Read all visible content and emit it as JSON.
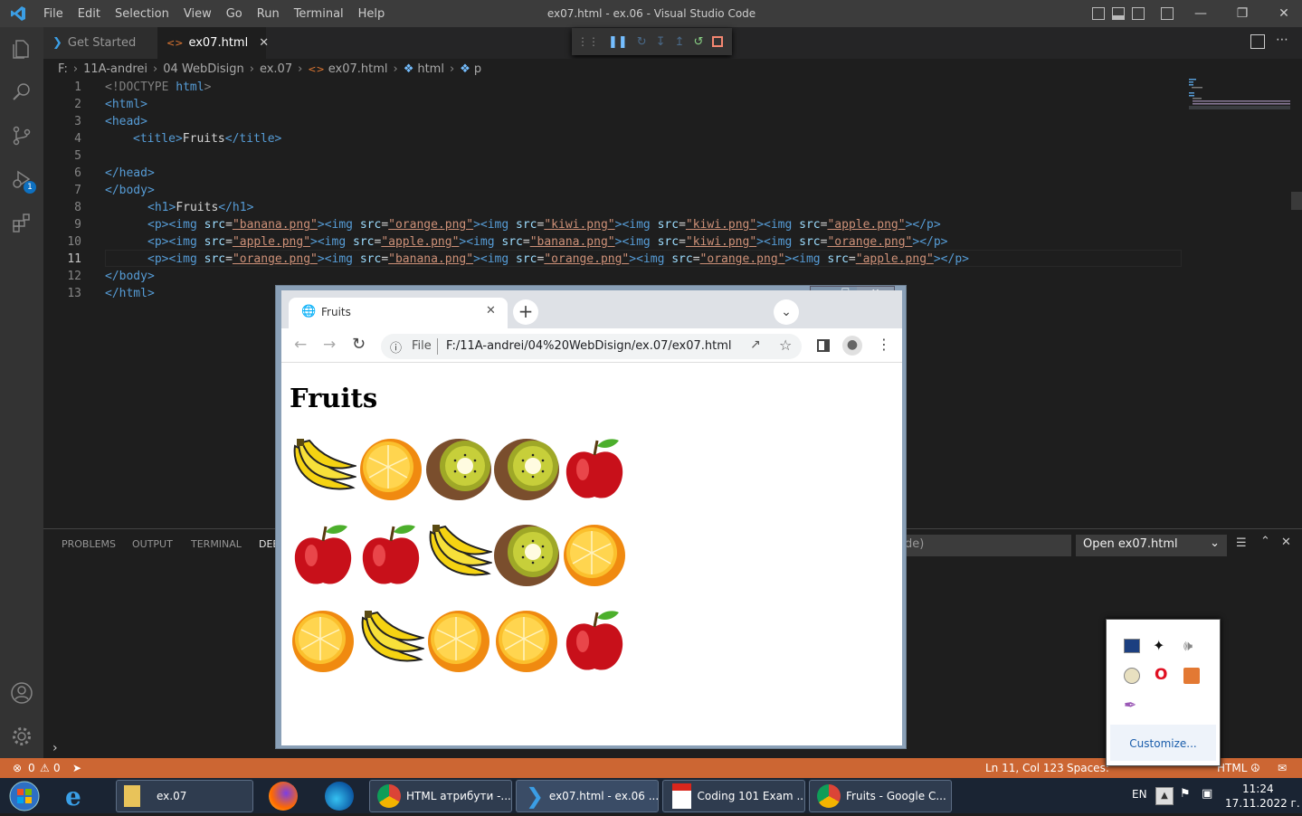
{
  "vscode": {
    "menu": [
      "File",
      "Edit",
      "Selection",
      "View",
      "Go",
      "Run",
      "Terminal",
      "Help"
    ],
    "window_title": "ex07.html - ex.06 - Visual Studio Code",
    "tabs": [
      {
        "label": "Get Started",
        "active": false
      },
      {
        "label": "ex07.html",
        "active": true
      }
    ],
    "breadcrumb": [
      "F:",
      "11A-andrei",
      "04 WebDisign",
      "ex.07",
      "ex07.html",
      "html",
      "p"
    ],
    "debug_badge": "1",
    "line_numbers": [
      "1",
      "2",
      "3",
      "4",
      "5",
      "6",
      "7",
      "8",
      "9",
      "10",
      "11",
      "12",
      "13"
    ],
    "code": {
      "l1_doctype": "<!DOCTYPE",
      "l1_html": " html",
      "l1_end": ">",
      "l2": "<html>",
      "l3": "<head>",
      "l4_open": "<title>",
      "l4_text": "Fruits",
      "l4_close": "</title>",
      "l6": "</head>",
      "l7": "</body>",
      "l8_open": "<h1>",
      "l8_text": "Fruits",
      "l8_close": "</h1>",
      "l9": [
        "banana.png",
        "orange.png",
        "kiwi.png",
        "kiwi.png",
        "apple.png"
      ],
      "l10": [
        "apple.png",
        "apple.png",
        "banana.png",
        "kiwi.png",
        "orange.png"
      ],
      "l11": [
        "orange.png",
        "banana.png",
        "orange.png",
        "orange.png",
        "apple.png"
      ],
      "l12": "</body>",
      "l13": "</html>",
      "p_open": "<p>",
      "p_close": "></p>",
      "img_open": "<img",
      "src_attr": " src",
      "eq": "=",
      "quote": "\"",
      "gt": ">"
    },
    "panel_tabs": [
      "PROBLEMS",
      "OUTPUT",
      "TERMINAL",
      "DEB"
    ],
    "debug_filter": "de)",
    "debug_select": "Open ex07.html",
    "status": {
      "errors": "0",
      "warnings": "0",
      "cursor": "Ln 11, Col 123",
      "spaces": "Spaces:",
      "lang": "HTML"
    }
  },
  "chrome": {
    "tab_title": "Fruits",
    "url_prefix": "File",
    "url": "F:/11A-andrei/04%20WebDisign/ex.07/ex07.html",
    "page_heading": "Fruits",
    "rows": [
      [
        "banana",
        "orange",
        "kiwi",
        "kiwi",
        "apple"
      ],
      [
        "apple",
        "apple",
        "banana",
        "kiwi",
        "orange"
      ],
      [
        "orange",
        "banana",
        "orange",
        "orange",
        "apple"
      ]
    ]
  },
  "tray": {
    "customize": "Customize..."
  },
  "taskbar": {
    "buttons": [
      "ex.07",
      "HTML атрибути -...",
      "ex07.html - ex.06 ...",
      "Coding 101 Exam ...",
      "Fruits - Google C..."
    ],
    "lang": "EN",
    "time": "11:24",
    "date": "17.11.2022 г."
  },
  "colors": {
    "status_bar": "#cc6633",
    "editor_bg": "#1e1e1e",
    "tag": "#569cd6",
    "attr": "#9cdcfe",
    "string": "#ce9178"
  }
}
